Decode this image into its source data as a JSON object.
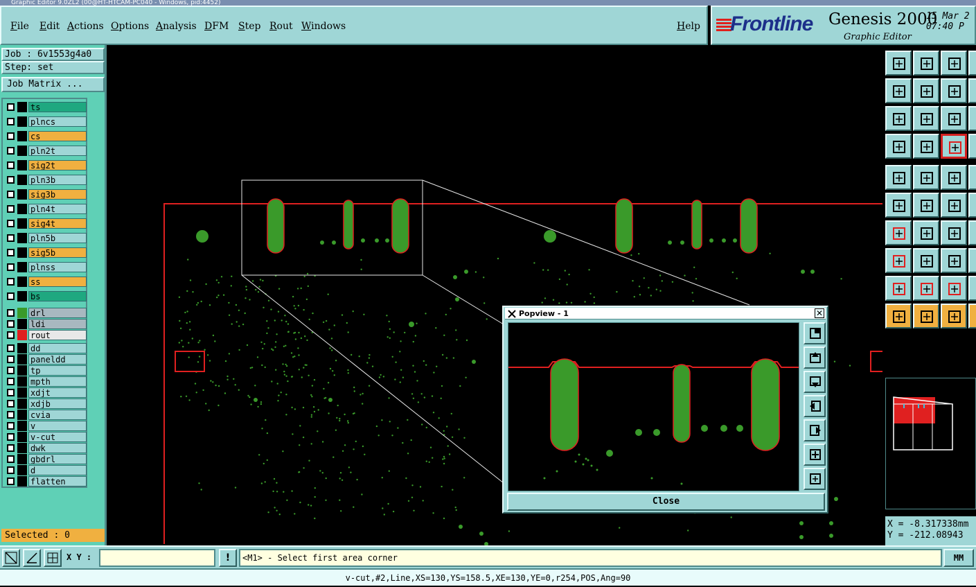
{
  "window_title": "Graphic Editor 9.0ZL2 (00@HT-HTCAM-PC040 - Windows, pid:4452)",
  "menu": {
    "items": [
      "File",
      "Edit",
      "Actions",
      "Options",
      "Analysis",
      "DFM",
      "Step",
      "Rout",
      "Windows"
    ],
    "help": "Help"
  },
  "brand": {
    "logo": "Frontline",
    "product": "Genesis 2000",
    "subtitle": "Graphic Editor",
    "date": "15 Mar 2\n07:40 P"
  },
  "left": {
    "job": "Job : 6v1553g4a0",
    "step": "Step: set",
    "job_matrix": "Job Matrix ...",
    "selected": "Selected : 0"
  },
  "layers": [
    {
      "name": "ts",
      "color": "#1fa880",
      "swatch": "#000"
    },
    {
      "name": "plncs",
      "color": "#9fd6d6",
      "swatch": "#000"
    },
    {
      "name": "cs",
      "color": "#f0b040",
      "swatch": "#000"
    },
    {
      "name": "pln2t",
      "color": "#9fd6d6",
      "swatch": "#000"
    },
    {
      "name": "sig2t",
      "color": "#f0b040",
      "swatch": "#000"
    },
    {
      "name": "pln3b",
      "color": "#9fd6d6",
      "swatch": "#000"
    },
    {
      "name": "sig3b",
      "color": "#f0b040",
      "swatch": "#000"
    },
    {
      "name": "pln4t",
      "color": "#9fd6d6",
      "swatch": "#000"
    },
    {
      "name": "sig4t",
      "color": "#f0b040",
      "swatch": "#000"
    },
    {
      "name": "pln5b",
      "color": "#9fd6d6",
      "swatch": "#000"
    },
    {
      "name": "sig5b",
      "color": "#f0b040",
      "swatch": "#000"
    },
    {
      "name": "plnss",
      "color": "#9fd6d6",
      "swatch": "#000"
    },
    {
      "name": "ss",
      "color": "#f0b040",
      "swatch": "#000"
    },
    {
      "name": "bs",
      "color": "#1fa880",
      "swatch": "#000"
    },
    {
      "name": "drl",
      "color": "#a8b8c0",
      "swatch": "#3a9a2a"
    },
    {
      "name": "ldi",
      "color": "#a8b8c0",
      "swatch": "#000"
    },
    {
      "name": "rout",
      "color": "#e8e8e8",
      "swatch": "#e02020"
    },
    {
      "name": "dd",
      "color": "#9fd6d6",
      "swatch": "#000"
    },
    {
      "name": "paneldd",
      "color": "#9fd6d6",
      "swatch": "#000"
    },
    {
      "name": "tp",
      "color": "#9fd6d6",
      "swatch": "#000"
    },
    {
      "name": "mpth",
      "color": "#9fd6d6",
      "swatch": "#000"
    },
    {
      "name": "xdjt",
      "color": "#9fd6d6",
      "swatch": "#000"
    },
    {
      "name": "xdjb",
      "color": "#9fd6d6",
      "swatch": "#000"
    },
    {
      "name": "cvia",
      "color": "#9fd6d6",
      "swatch": "#000"
    },
    {
      "name": "v",
      "color": "#9fd6d6",
      "swatch": "#000"
    },
    {
      "name": "v-cut",
      "color": "#9fd6d6",
      "swatch": "#000"
    },
    {
      "name": "dwk",
      "color": "#9fd6d6",
      "swatch": "#000"
    },
    {
      "name": "gbdrl",
      "color": "#9fd6d6",
      "swatch": "#000"
    },
    {
      "name": "d",
      "color": "#9fd6d6",
      "swatch": "#000"
    },
    {
      "name": "flatten",
      "color": "#9fd6d6",
      "swatch": "#000"
    }
  ],
  "popview": {
    "title": "Popview - 1",
    "close": "Close"
  },
  "coords": {
    "x": "X = -8.317338mm",
    "y": "Y = -212.08943"
  },
  "bottom": {
    "xy_label": "X Y :",
    "xy_value": "",
    "prompt": "<M1> - Select first area corner",
    "units": "MM"
  },
  "status": "v-cut,#2,Line,XS=130,YS=158.5,XE=130,YE=0,r254,POS,Ang=90",
  "colors": {
    "panel": "#9fd6d6",
    "accent": "#5fd0b6",
    "rout": "#e02020",
    "pad": "#3a9a2a"
  }
}
